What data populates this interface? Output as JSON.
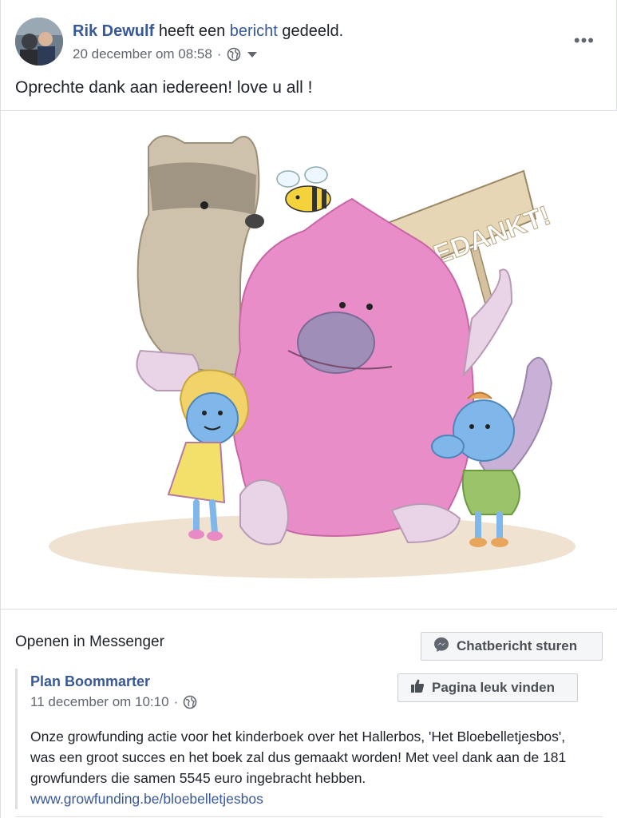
{
  "post": {
    "author": "Rik Dewulf",
    "action_pre": "heeft een",
    "action_link": "bericht",
    "action_post": "gedeeld.",
    "timestamp": "20 december om 08:58",
    "dot": "·",
    "more": "•••",
    "message": "Oprechte dank aan iedereen! love u all !"
  },
  "illustration": {
    "sign_text": "BEDANKT!"
  },
  "shared": {
    "messenger_label": "Openen in Messenger",
    "chat_button": "Chatbericht sturen",
    "page_name": "Plan Boommarter",
    "page_timestamp": "11 december om 10:10",
    "dot": "·",
    "like_button": "Pagina leuk vinden",
    "text": "Onze growfunding actie voor het kinderboek over het Hallerbos, 'Het Bloebelletjesbos', was een groot succes en het boek zal dus gemaakt worden! Met veel dank aan de 181 growfunders die samen 5545 euro ingebracht hebben.",
    "link": "www.growfunding.be/bloebelletjesbos"
  },
  "colors": {
    "link": "#385898",
    "monster": "#e98dc9",
    "creature": "#7fb7ea",
    "marten": "#cfc2ad"
  }
}
